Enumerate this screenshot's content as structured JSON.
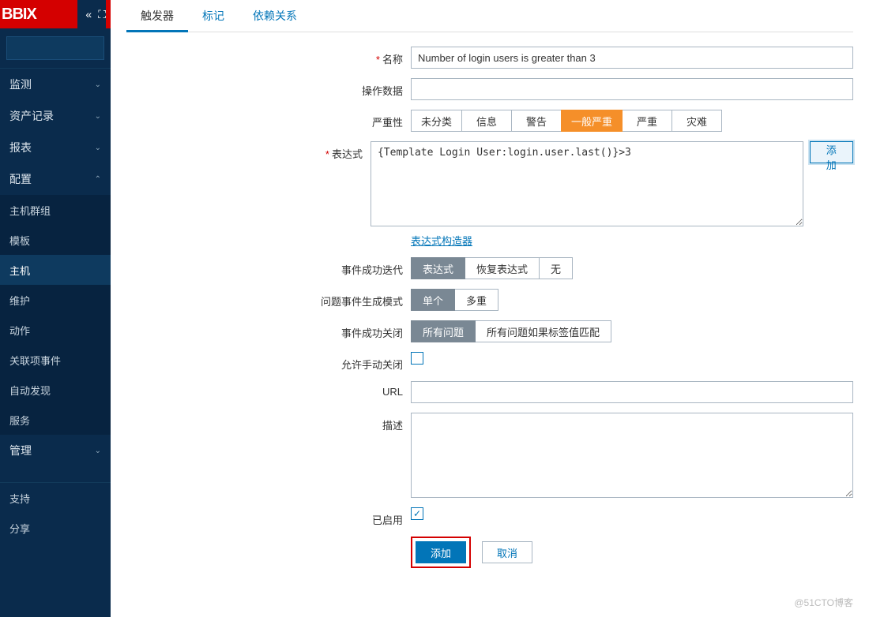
{
  "logo": "BBIX",
  "sidebar": {
    "items": [
      {
        "label": "监测",
        "expanded": false
      },
      {
        "label": "资产记录",
        "expanded": false
      },
      {
        "label": "报表",
        "expanded": false
      },
      {
        "label": "配置",
        "expanded": true,
        "sub": [
          {
            "label": "主机群组"
          },
          {
            "label": "模板"
          },
          {
            "label": "主机"
          },
          {
            "label": "维护"
          },
          {
            "label": "动作"
          },
          {
            "label": "关联项事件"
          },
          {
            "label": "自动发现"
          },
          {
            "label": "服务"
          }
        ]
      },
      {
        "label": "管理",
        "expanded": false
      }
    ],
    "footer": [
      {
        "label": "支持"
      },
      {
        "label": "分享"
      }
    ]
  },
  "tabs": [
    {
      "label": "触发器",
      "active": true
    },
    {
      "label": "标记",
      "active": false
    },
    {
      "label": "依赖关系",
      "active": false
    }
  ],
  "form": {
    "name_label": "名称",
    "name_value": "Number of login users is greater than 3",
    "opdata_label": "操作数据",
    "opdata_value": "",
    "severity_label": "严重性",
    "severity_options": [
      "未分类",
      "信息",
      "警告",
      "一般严重",
      "严重",
      "灾难"
    ],
    "severity_selected": 3,
    "expression_label": "表达式",
    "expression_value": "{Template Login User:login.user.last()}>3",
    "add_expr_button": "添加",
    "expr_builder_link": "表达式构造器",
    "ok_event_label": "事件成功迭代",
    "ok_event_options": [
      "表达式",
      "恢复表达式",
      "无"
    ],
    "ok_event_selected": 0,
    "problem_mode_label": "问题事件生成模式",
    "problem_mode_options": [
      "单个",
      "多重"
    ],
    "problem_mode_selected": 0,
    "ok_close_label": "事件成功关闭",
    "ok_close_options": [
      "所有问题",
      "所有问题如果标签值匹配"
    ],
    "ok_close_selected": 0,
    "manual_close_label": "允许手动关闭",
    "manual_close_checked": false,
    "url_label": "URL",
    "url_value": "",
    "desc_label": "描述",
    "desc_value": "",
    "enabled_label": "已启用",
    "enabled_checked": true,
    "submit_label": "添加",
    "cancel_label": "取消"
  },
  "watermark": "@51CTO博客"
}
